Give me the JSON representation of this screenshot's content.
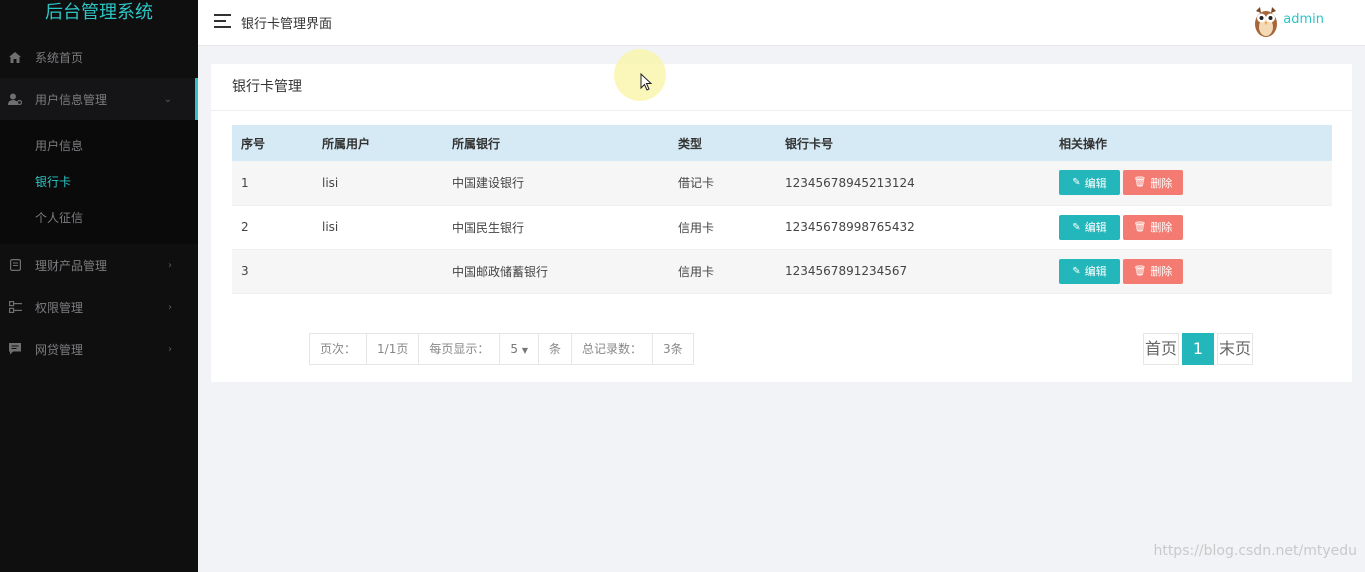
{
  "app": {
    "brand": "后台管理系统"
  },
  "header": {
    "title": "银行卡管理界面",
    "username": "admin"
  },
  "sidebar": {
    "items": [
      {
        "label": "系统首页",
        "icon": "home-icon"
      },
      {
        "label": "用户信息管理",
        "icon": "user-settings-icon",
        "arrow": "⌄",
        "children": [
          {
            "label": "用户信息"
          },
          {
            "label": "银行卡"
          },
          {
            "label": "个人征信"
          }
        ]
      },
      {
        "label": "理财产品管理",
        "icon": "document-icon",
        "arrow": "›"
      },
      {
        "label": "权限管理",
        "icon": "key-icon",
        "arrow": "›"
      },
      {
        "label": "网贷管理",
        "icon": "message-icon",
        "arrow": "›"
      }
    ]
  },
  "panel": {
    "title": "银行卡管理"
  },
  "table": {
    "columns": [
      "序号",
      "所属用户",
      "所属银行",
      "类型",
      "银行卡号",
      "相关操作"
    ],
    "rows": [
      {
        "no": "1",
        "user": "lisi",
        "bank": "中国建设银行",
        "type": "借记卡",
        "card": "12345678945213124"
      },
      {
        "no": "2",
        "user": "lisi",
        "bank": "中国民生银行",
        "type": "信用卡",
        "card": "12345678998765432"
      },
      {
        "no": "3",
        "user": "",
        "bank": "中国邮政储蓄银行",
        "type": "信用卡",
        "card": "1234567891234567"
      }
    ],
    "edit_label": "编辑",
    "delete_label": "删除"
  },
  "pager": {
    "page_label": "页次：",
    "page_value": "1/1页",
    "per_page_label": "每页显示：",
    "per_page_value": "5",
    "per_page_unit": "条",
    "total_label": "总记录数：",
    "total_value": "3条",
    "first": "首页",
    "current": "1",
    "last": "末页"
  },
  "watermark": "https://blog.csdn.net/mtyedu",
  "colors": {
    "accent": "#23b7bb",
    "danger": "#f47b71",
    "sidebar": "#0f0f10",
    "table_header": "#d6eaf5"
  }
}
